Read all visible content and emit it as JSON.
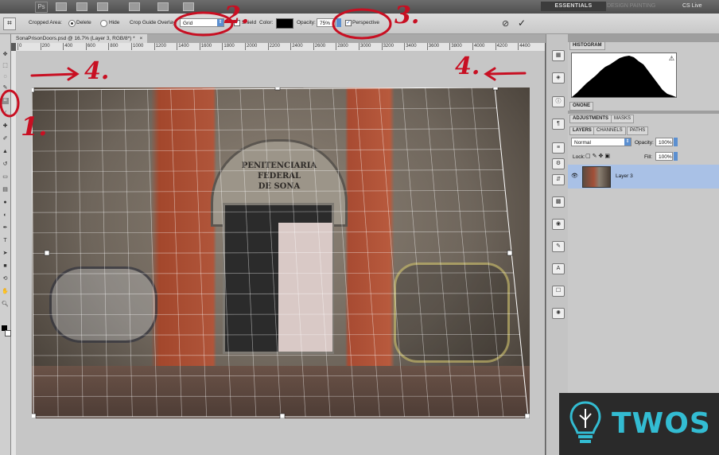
{
  "app": {
    "logo": "Ps",
    "workspace": "ESSENTIALS",
    "workspace_others": "DESIGN   PAINTING",
    "cs_live": "CS Live"
  },
  "options": {
    "cropped_area_label": "Cropped Area:",
    "delete_label": "Delete",
    "hide_label": "Hide",
    "overlay_label": "Crop Guide Overlay:",
    "overlay_value": "Grid",
    "shield_label": "Shield",
    "color_label": "Color:",
    "opacity_label": "Opacity:",
    "opacity_value": "75%",
    "perspective_label": "Perspective",
    "cancel_glyph": "⊘",
    "commit_glyph": "✓"
  },
  "document": {
    "tab_title": "SonaPrisonDoors.psd @ 16.7% (Layer 3, RGB/8*) *",
    "close_glyph": "×"
  },
  "ruler_ticks": [
    "0",
    "200",
    "400",
    "600",
    "800",
    "1000",
    "1200",
    "1400",
    "1600",
    "1800",
    "2000",
    "2200",
    "2400",
    "2600",
    "2800",
    "3000",
    "3200",
    "3400",
    "3600",
    "3800",
    "4000",
    "4200",
    "4400"
  ],
  "photo": {
    "sign_line1": "PENITENCIARIA",
    "sign_line2": "FEDERAL",
    "sign_line3": "DE SONA"
  },
  "panels": {
    "histogram_tab": "HISTOGRAM",
    "onone_tab": "ONONE",
    "adjustments_tab": "ADJUSTMENTS",
    "masks_tab": "MASKS",
    "layers_tab": "LAYERS",
    "channels_tab": "CHANNELS",
    "paths_tab": "PATHS",
    "blend_mode": "Normal",
    "opacity_label": "Opacity:",
    "opacity_value": "100%",
    "lock_label": "Lock:",
    "fill_label": "Fill:",
    "fill_value": "100%",
    "layer_name": "Layer 3"
  },
  "annotations": {
    "one": "1.",
    "two": "2.",
    "three": "3.",
    "four_left": "4.",
    "four_right": "4."
  },
  "watermark": {
    "text": "TWOS"
  },
  "colors": {
    "annotation": "#c80f22",
    "watermark_text": "#33bcd2",
    "selection": "#a9c1e6"
  }
}
